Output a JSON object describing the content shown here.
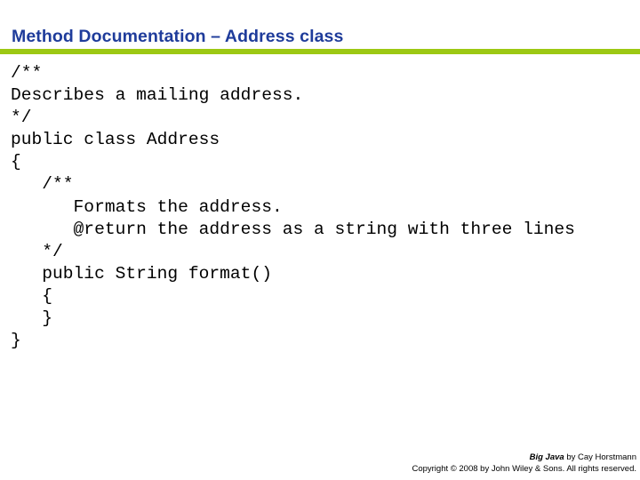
{
  "slide": {
    "title": "Method Documentation – Address class",
    "title_color": "#1F3C9B",
    "rule_color": "#9CC813",
    "background_color": "#FFFFFF"
  },
  "code": {
    "language": "java",
    "text_color": "#000000",
    "lines": [
      "/**",
      "Describes a mailing address.",
      "*/",
      "public class Address",
      "{",
      "   /**",
      "      Formats the address.",
      "      @return the address as a string with three lines",
      "   */",
      "   public String format()",
      "   {",
      "   }",
      "}"
    ]
  },
  "footer": {
    "book_title": "Big Java",
    "credit_rest": " by Cay Horstmann",
    "copyright": "Copyright © 2008 by John Wiley & Sons.  All rights reserved."
  }
}
